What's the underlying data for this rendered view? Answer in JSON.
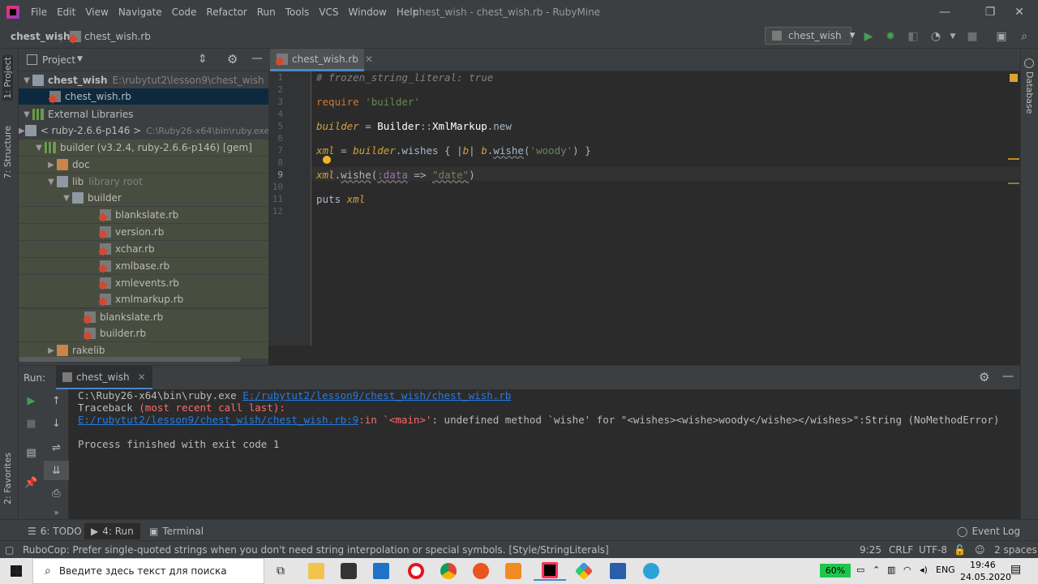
{
  "window": {
    "title": "chest_wish - chest_wish.rb - RubyMine",
    "menu": [
      "File",
      "Edit",
      "View",
      "Navigate",
      "Code",
      "Refactor",
      "Run",
      "Tools",
      "VCS",
      "Window",
      "Help"
    ]
  },
  "navbar": {
    "project": "chest_wish",
    "file": "chest_wish.rb",
    "run_config": "chest_wish"
  },
  "left_stripe": {
    "project_tab": "1: Project",
    "structure_tab": "7: Structure",
    "favorites_tab": "2: Favorites"
  },
  "right_stripe": {
    "database_tab": "Database"
  },
  "project_panel": {
    "title": "Project",
    "tree": [
      {
        "label": "chest_wish",
        "extra": "E:\\rubytut2\\lesson9\\chest_wish"
      },
      {
        "label": "chest_wish.rb"
      },
      {
        "label": "External Libraries"
      },
      {
        "label": "< ruby-2.6.6-p146 >",
        "extra": "C:\\Ruby26-x64\\bin\\ruby.exe"
      },
      {
        "label": "builder (v3.2.4, ruby-2.6.6-p146) [gem]"
      },
      {
        "label": "doc"
      },
      {
        "label": "lib",
        "extra": "library root"
      },
      {
        "label": "builder"
      },
      {
        "label": "blankslate.rb"
      },
      {
        "label": "version.rb"
      },
      {
        "label": "xchar.rb"
      },
      {
        "label": "xmlbase.rb"
      },
      {
        "label": "xmlevents.rb"
      },
      {
        "label": "xmlmarkup.rb"
      },
      {
        "label": "blankslate.rb"
      },
      {
        "label": "builder.rb"
      },
      {
        "label": "rakelib"
      }
    ]
  },
  "editor": {
    "tab": "chest_wish.rb",
    "line_numbers": [
      "1",
      "2",
      "3",
      "4",
      "5",
      "6",
      "7",
      "8",
      "9",
      "10",
      "11",
      "12"
    ],
    "lines": [
      {
        "n": 1,
        "text": "# frozen_string_literal: true"
      },
      {
        "n": 3,
        "text": "require 'builder'"
      },
      {
        "n": 5,
        "text": "builder = Builder::XmlMarkup.new"
      },
      {
        "n": 7,
        "text": "xml = builder.wishes { |b| b.wishe('woody') }"
      },
      {
        "n": 9,
        "text": "xml.wishe(:data => \"date\")"
      },
      {
        "n": 11,
        "text": "puts xml"
      }
    ],
    "tokens": {
      "l1": "# frozen_string_literal: true",
      "require": "require",
      "builder_str": "'builder'",
      "builder_var": "builder",
      "eq": " = ",
      "const": "Builder",
      "sep": "::",
      "xmlmarkup": "XmlMarkup",
      "dot": ".",
      "new": "new",
      "xml": "xml",
      "wishes": "wishes",
      "brace_open": " { |",
      "b": "b",
      "pipe": "| ",
      "wishe": "wishe",
      "paren_open": "(",
      "woody": "'woody'",
      "brace_close": ") }",
      "sym": ":data",
      "arrow": " => ",
      "date": "\"date\"",
      "paren_close": ")",
      "puts": "puts "
    }
  },
  "run_panel": {
    "label": "Run:",
    "tab": "chest_wish",
    "console": {
      "cmd": "C:\\Ruby26-x64\\bin\\ruby.exe ",
      "cmd_path": "E:/rubytut2/lesson9/chest_wish/chest_wish.rb",
      "traceback": "Traceback ",
      "traceback_note": "(most recent call last):",
      "err_link": "E:/rubytut2/lesson9/chest_wish/chest_wish.rb:9",
      "err_in": ":in `<main>'",
      "err_msg": ": undefined method `wishe' for \"<wishes><wishe>woody</wishe></wishes>\":String (NoMethodError)",
      "finished": "Process finished with exit code 1"
    }
  },
  "tool_tabs": {
    "todo": "6: TODO",
    "run": "4: Run",
    "terminal": "Terminal",
    "event_log": "Event Log"
  },
  "status_bar": {
    "message": "RuboCop: Prefer single-quoted strings when you don't need string interpolation or special symbols. [Style/StringLiterals]",
    "position": "9:25",
    "line_sep": "CRLF",
    "encoding": "UTF-8",
    "indent": "2 spaces"
  },
  "taskbar": {
    "search_placeholder": "Введите здесь текст для поиска",
    "battery": "60%",
    "lang": "ENG",
    "time": "19:46",
    "date": "24.05.2020"
  },
  "colors": {
    "accent": "#4a88c7",
    "run_green": "#499c54",
    "link": "#287bde",
    "error": "#ff6b68"
  }
}
